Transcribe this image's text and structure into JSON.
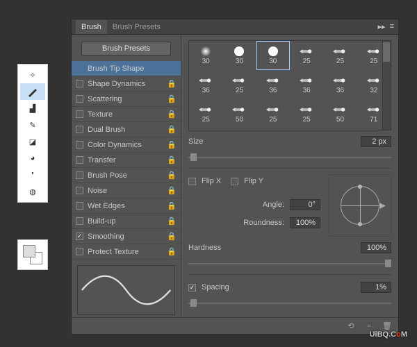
{
  "tabs": {
    "brush": "Brush",
    "presets": "Brush Presets"
  },
  "preset_button": "Brush Presets",
  "options": [
    {
      "label": "Brush Tip Shape",
      "checkbox": false,
      "lock": false,
      "selected": true
    },
    {
      "label": "Shape Dynamics",
      "checkbox": true,
      "checked": false,
      "lock": true
    },
    {
      "label": "Scattering",
      "checkbox": true,
      "checked": false,
      "lock": true
    },
    {
      "label": "Texture",
      "checkbox": true,
      "checked": false,
      "lock": true
    },
    {
      "label": "Dual Brush",
      "checkbox": true,
      "checked": false,
      "lock": true
    },
    {
      "label": "Color Dynamics",
      "checkbox": true,
      "checked": false,
      "lock": true
    },
    {
      "label": "Transfer",
      "checkbox": true,
      "checked": false,
      "lock": true
    },
    {
      "label": "Brush Pose",
      "checkbox": true,
      "checked": false,
      "lock": true
    },
    {
      "label": "Noise",
      "checkbox": true,
      "checked": false,
      "lock": true
    },
    {
      "label": "Wet Edges",
      "checkbox": true,
      "checked": false,
      "lock": true
    },
    {
      "label": "Build-up",
      "checkbox": true,
      "checked": false,
      "lock": true
    },
    {
      "label": "Smoothing",
      "checkbox": true,
      "checked": true,
      "lock": true
    },
    {
      "label": "Protect Texture",
      "checkbox": true,
      "checked": false,
      "lock": true
    }
  ],
  "brushes": [
    {
      "label": "30",
      "type": "soft"
    },
    {
      "label": "30",
      "type": "hard"
    },
    {
      "label": "30",
      "type": "hard",
      "sel": true
    },
    {
      "label": "25",
      "type": "chisel"
    },
    {
      "label": "25",
      "type": "chisel"
    },
    {
      "label": "25",
      "type": "chisel"
    },
    {
      "label": "36",
      "type": "chisel"
    },
    {
      "label": "25",
      "type": "chisel"
    },
    {
      "label": "36",
      "type": "chisel"
    },
    {
      "label": "36",
      "type": "chisel"
    },
    {
      "label": "36",
      "type": "chisel"
    },
    {
      "label": "32",
      "type": "chisel"
    },
    {
      "label": "25",
      "type": "chisel"
    },
    {
      "label": "50",
      "type": "chisel"
    },
    {
      "label": "25",
      "type": "chisel"
    },
    {
      "label": "25",
      "type": "chisel"
    },
    {
      "label": "50",
      "type": "chisel"
    },
    {
      "label": "71",
      "type": "chisel"
    }
  ],
  "labels": {
    "size": "Size",
    "flipx": "Flip X",
    "flipy": "Flip Y",
    "angle": "Angle:",
    "round": "Roundness:",
    "hard": "Hardness",
    "spacing": "Spacing"
  },
  "values": {
    "size": "2 px",
    "angle": "0°",
    "round": "100%",
    "hard": "100%",
    "spacing": "1%"
  },
  "watermark": {
    "pre": "UiBQ.C",
    "o": "o",
    "post": "M"
  }
}
